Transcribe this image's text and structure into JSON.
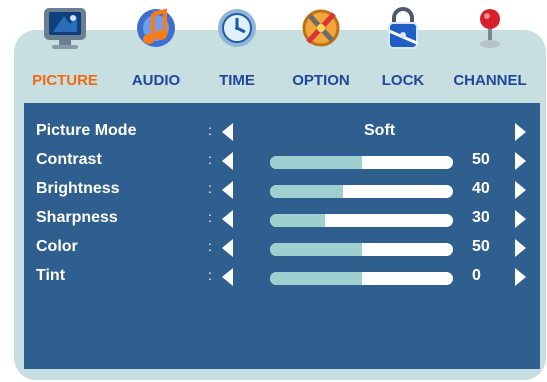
{
  "tabs": [
    {
      "label": "PICTURE",
      "icon": "tv-monitor-icon",
      "active": true
    },
    {
      "label": "AUDIO",
      "icon": "music-note-icon",
      "active": false
    },
    {
      "label": "TIME",
      "icon": "clock-icon",
      "active": false
    },
    {
      "label": "OPTION",
      "icon": "tools-icon",
      "active": false
    },
    {
      "label": "LOCK",
      "icon": "padlock-icon",
      "active": false
    },
    {
      "label": "CHANNEL",
      "icon": "channel-pin-icon",
      "active": false
    }
  ],
  "settings": {
    "picture_mode": {
      "label": "Picture Mode",
      "value": "Soft"
    },
    "contrast": {
      "label": "Contrast",
      "value": "50",
      "level": 0.5
    },
    "brightness": {
      "label": "Brightness",
      "value": "40",
      "level": 0.4
    },
    "sharpness": {
      "label": "Sharpness",
      "value": "30",
      "level": 0.3
    },
    "color": {
      "label": "Color",
      "value": "50",
      "level": 0.5
    },
    "tint": {
      "label": "Tint",
      "value": "0",
      "level": 0.5
    }
  },
  "separator": ":",
  "colors": {
    "frame": "#c7dfe1",
    "panel": "#2f5f8e",
    "tab_label": "#21469b",
    "tab_active": "#f26a0c",
    "bar_track": "#ffffff",
    "bar_fill": "#9fd0cf"
  }
}
